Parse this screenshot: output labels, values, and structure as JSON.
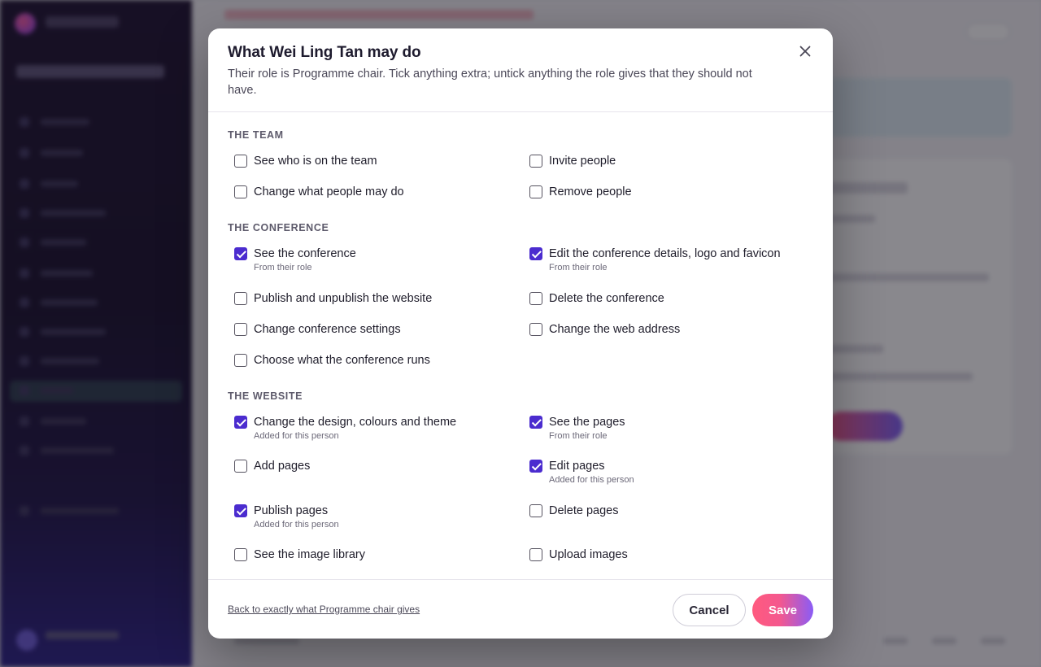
{
  "dialog": {
    "title": "What Wei Ling Tan may do",
    "subtitle": "Their role is Programme chair. Tick anything extra; untick anything the role gives that they should not have.",
    "close_icon": "close-icon",
    "checkbox_color": "#4b2ccf"
  },
  "sections": [
    {
      "heading": "THE TEAM",
      "permissions": [
        {
          "label": "See who is on the team",
          "checked": false,
          "note": ""
        },
        {
          "label": "Invite people",
          "checked": false,
          "note": ""
        },
        {
          "label": "Change what people may do",
          "checked": false,
          "note": ""
        },
        {
          "label": "Remove people",
          "checked": false,
          "note": ""
        }
      ]
    },
    {
      "heading": "THE CONFERENCE",
      "permissions": [
        {
          "label": "See the conference",
          "checked": true,
          "note": "From their role"
        },
        {
          "label": "Edit the conference details, logo and favicon",
          "checked": true,
          "note": "From their role"
        },
        {
          "label": "Publish and unpublish the website",
          "checked": false,
          "note": ""
        },
        {
          "label": "Delete the conference",
          "checked": false,
          "note": ""
        },
        {
          "label": "Change conference settings",
          "checked": false,
          "note": ""
        },
        {
          "label": "Change the web address",
          "checked": false,
          "note": ""
        },
        {
          "label": "Choose what the conference runs",
          "checked": false,
          "note": ""
        }
      ]
    },
    {
      "heading": "THE WEBSITE",
      "permissions": [
        {
          "label": "Change the design, colours and theme",
          "checked": true,
          "note": "Added for this person"
        },
        {
          "label": "See the pages",
          "checked": true,
          "note": "From their role"
        },
        {
          "label": "Add pages",
          "checked": false,
          "note": ""
        },
        {
          "label": "Edit pages",
          "checked": true,
          "note": "Added for this person"
        },
        {
          "label": "Publish pages",
          "checked": true,
          "note": "Added for this person"
        },
        {
          "label": "Delete pages",
          "checked": false,
          "note": ""
        },
        {
          "label": "See the image library",
          "checked": false,
          "note": ""
        },
        {
          "label": "Upload images",
          "checked": false,
          "note": ""
        }
      ]
    }
  ],
  "footer": {
    "reset_link": "Back to exactly what Programme chair gives",
    "cancel_label": "Cancel",
    "save_label": "Save"
  }
}
